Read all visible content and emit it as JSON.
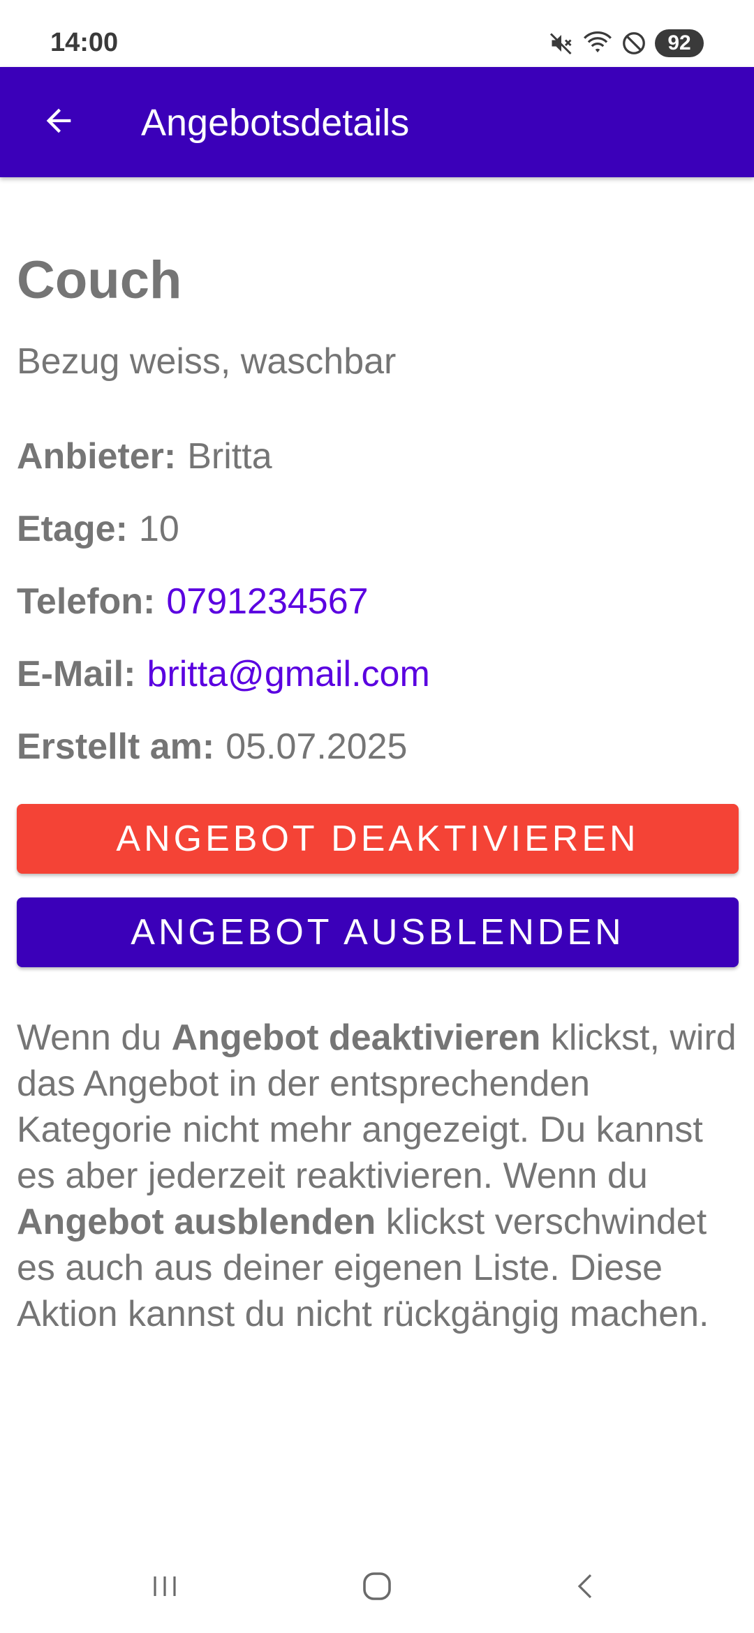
{
  "status_bar": {
    "time": "14:00",
    "battery": "92",
    "icons": [
      "mute-icon",
      "wifi-icon",
      "do-not-disturb-icon"
    ]
  },
  "app_bar": {
    "title": "Angebotsdetails",
    "back_icon": "arrow-back-icon"
  },
  "offer": {
    "title": "Couch",
    "description": "Bezug weiss, waschbar",
    "fields": {
      "provider_label": "Anbieter:",
      "provider_value": "Britta",
      "floor_label": "Etage:",
      "floor_value": "10",
      "phone_label": "Telefon:",
      "phone_value": "0791234567",
      "email_label": "E-Mail:",
      "email_value": "britta@gmail.com",
      "created_label": "Erstellt am:",
      "created_value": "05.07.2025"
    }
  },
  "buttons": {
    "deactivate": "ANGEBOT DEAKTIVIEREN",
    "hide": "ANGEBOT AUSBLENDEN"
  },
  "explanation": {
    "part1": "Wenn du ",
    "bold1": "Angebot deaktivieren",
    "part2": " klickst, wird das Angebot in der entsprechenden Kategorie nicht mehr angezeigt. Du kannst es aber jederzeit reaktivieren. Wenn du ",
    "bold2": "Angebot ausblenden",
    "part3": " klickst verschwindet es auch aus deiner eigenen Liste. Diese Aktion kannst du nicht rückgängig machen."
  },
  "nav_bar": {
    "icons": [
      "recent-apps-icon",
      "home-icon",
      "back-icon"
    ]
  },
  "colors": {
    "primary": "#3b00b9",
    "danger": "#f44336",
    "link": "#5a00e0",
    "text": "#757575"
  }
}
